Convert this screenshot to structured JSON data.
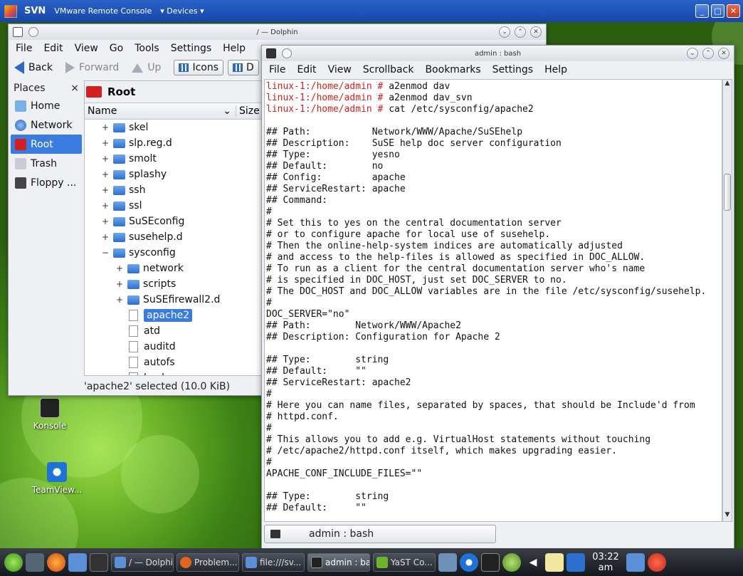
{
  "vm": {
    "name": "SVN",
    "app": "VMware Remote Console",
    "menu": "Devices",
    "minimize": "_",
    "maximize": "□",
    "close": "✕"
  },
  "colors": {
    "accent": "#3a7be0",
    "prompt": "#d21f1f",
    "titlebar": "#1f55b8"
  },
  "desktop": {
    "icons": [
      {
        "label": "Konsole",
        "icon": "terminal-icon"
      },
      {
        "label": "TeamView...",
        "icon": "teamviewer-icon"
      }
    ]
  },
  "dolphin": {
    "title": "/ — Dolphin",
    "controls": {
      "minimize": "⌄",
      "maximize": "⌃",
      "close": "✕"
    },
    "menu": [
      "File",
      "Edit",
      "View",
      "Go",
      "Tools",
      "Settings",
      "Help"
    ],
    "toolbar": {
      "back": "Back",
      "forward": "Forward",
      "up": "Up",
      "icons": "Icons",
      "details": "D"
    },
    "places": {
      "title": "Places",
      "close": "×",
      "items": [
        {
          "label": "Home",
          "icon": "home-icon"
        },
        {
          "label": "Network",
          "icon": "network-icon"
        },
        {
          "label": "Root",
          "icon": "root-folder-icon",
          "active": true
        },
        {
          "label": "Trash",
          "icon": "trash-icon"
        },
        {
          "label": "Floppy ...",
          "icon": "floppy-icon"
        }
      ]
    },
    "location": "Root",
    "columns": {
      "name": "Name",
      "size": "Size"
    },
    "tree": [
      {
        "label": "skel",
        "level": 0,
        "expander": "+",
        "type": "folder"
      },
      {
        "label": "slp.reg.d",
        "level": 0,
        "expander": "+",
        "type": "folder"
      },
      {
        "label": "smolt",
        "level": 0,
        "expander": "+",
        "type": "folder"
      },
      {
        "label": "splashy",
        "level": 0,
        "expander": "+",
        "type": "folder"
      },
      {
        "label": "ssh",
        "level": 0,
        "expander": "+",
        "type": "folder"
      },
      {
        "label": "ssl",
        "level": 0,
        "expander": "+",
        "type": "folder"
      },
      {
        "label": "SuSEconfig",
        "level": 0,
        "expander": "+",
        "type": "folder"
      },
      {
        "label": "susehelp.d",
        "level": 0,
        "expander": "+",
        "type": "folder"
      },
      {
        "label": "sysconfig",
        "level": 0,
        "expander": "−",
        "type": "folder"
      },
      {
        "label": "network",
        "level": 1,
        "expander": "+",
        "type": "folder"
      },
      {
        "label": "scripts",
        "level": 1,
        "expander": "+",
        "type": "folder"
      },
      {
        "label": "SuSEfirewall2.d",
        "level": 1,
        "expander": "+",
        "type": "folder"
      },
      {
        "label": "apache2",
        "level": 1,
        "expander": "",
        "type": "file",
        "selected": true
      },
      {
        "label": "atd",
        "level": 1,
        "expander": "",
        "type": "file"
      },
      {
        "label": "auditd",
        "level": 1,
        "expander": "",
        "type": "file"
      },
      {
        "label": "autofs",
        "level": 1,
        "expander": "",
        "type": "file"
      },
      {
        "label": "backup",
        "level": 1,
        "expander": "",
        "type": "file"
      }
    ],
    "status": "'apache2' selected (10.0 KiB)"
  },
  "konsole": {
    "title": "admin : bash",
    "controls": {
      "minimize": "⌄",
      "maximize": "⌃",
      "close": "✕"
    },
    "menu": [
      "File",
      "Edit",
      "View",
      "Scrollback",
      "Bookmarks",
      "Settings",
      "Help"
    ],
    "lines": [
      {
        "prompt": "linux-1:/home/admin # ",
        "text": "a2enmod dav"
      },
      {
        "prompt": "linux-1:/home/admin # ",
        "text": "a2enmod dav_svn"
      },
      {
        "prompt": "linux-1:/home/admin # ",
        "text": "cat /etc/sysconfig/apache2"
      },
      {
        "prompt": "",
        "text": ""
      },
      {
        "prompt": "",
        "text": "## Path:           Network/WWW/Apache/SuSEhelp"
      },
      {
        "prompt": "",
        "text": "## Description:    SuSE help doc server configuration"
      },
      {
        "prompt": "",
        "text": "## Type:           yesno"
      },
      {
        "prompt": "",
        "text": "## Default:        no"
      },
      {
        "prompt": "",
        "text": "## Config:         apache"
      },
      {
        "prompt": "",
        "text": "## ServiceRestart: apache"
      },
      {
        "prompt": "",
        "text": "## Command:"
      },
      {
        "prompt": "",
        "text": "#"
      },
      {
        "prompt": "",
        "text": "# Set this to yes on the central documentation server"
      },
      {
        "prompt": "",
        "text": "# or to configure apache for local use of susehelp."
      },
      {
        "prompt": "",
        "text": "# Then the online-help-system indices are automatically adjusted"
      },
      {
        "prompt": "",
        "text": "# and access to the help-files is allowed as specified in DOC_ALLOW."
      },
      {
        "prompt": "",
        "text": "# To run as a client for the central documentation server who's name"
      },
      {
        "prompt": "",
        "text": "# is specified in DOC_HOST, just set DOC_SERVER to no."
      },
      {
        "prompt": "",
        "text": "# The DOC_HOST and DOC_ALLOW variables are in the file /etc/sysconfig/susehelp."
      },
      {
        "prompt": "",
        "text": "#"
      },
      {
        "prompt": "",
        "text": "DOC_SERVER=\"no\""
      },
      {
        "prompt": "",
        "text": "## Path:        Network/WWW/Apache2"
      },
      {
        "prompt": "",
        "text": "## Description: Configuration for Apache 2"
      },
      {
        "prompt": "",
        "text": ""
      },
      {
        "prompt": "",
        "text": "## Type:        string"
      },
      {
        "prompt": "",
        "text": "## Default:     \"\""
      },
      {
        "prompt": "",
        "text": "## ServiceRestart: apache2"
      },
      {
        "prompt": "",
        "text": "#"
      },
      {
        "prompt": "",
        "text": "# Here you can name files, separated by spaces, that should be Include'd from"
      },
      {
        "prompt": "",
        "text": "# httpd.conf."
      },
      {
        "prompt": "",
        "text": "#"
      },
      {
        "prompt": "",
        "text": "# This allows you to add e.g. VirtualHost statements without touching"
      },
      {
        "prompt": "",
        "text": "# /etc/apache2/httpd.conf itself, which makes upgrading easier."
      },
      {
        "prompt": "",
        "text": "#"
      },
      {
        "prompt": "",
        "text": "APACHE_CONF_INCLUDE_FILES=\"\""
      },
      {
        "prompt": "",
        "text": ""
      },
      {
        "prompt": "",
        "text": "## Type:        string"
      },
      {
        "prompt": "",
        "text": "## Default:     \"\""
      }
    ],
    "tab_label": "admin : bash"
  },
  "taskbar": {
    "tasks": [
      {
        "label": "/ — Dolphin",
        "icon": "dolphin-icon"
      },
      {
        "label": "Problem...",
        "icon": "firefox-icon"
      },
      {
        "label": "file:///sv...",
        "icon": "file-browser-icon"
      },
      {
        "label": "admin : ba...",
        "icon": "terminal-icon",
        "active": true
      },
      {
        "label": "YaST Co...",
        "icon": "yast-icon"
      }
    ],
    "clock": "03:22 am"
  }
}
